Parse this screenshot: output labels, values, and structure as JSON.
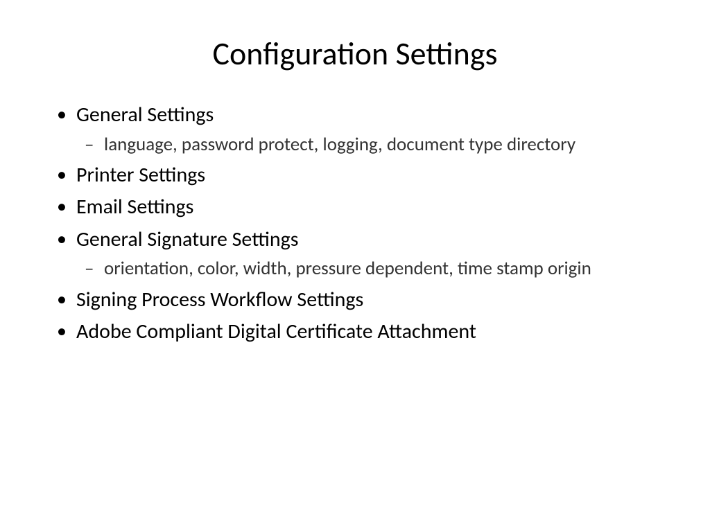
{
  "slide": {
    "title": "Configuration Settings",
    "bullets": [
      {
        "text": "General Settings",
        "sub": [
          "language, password protect, logging, document type directory"
        ]
      },
      {
        "text": "Printer Settings",
        "sub": []
      },
      {
        "text": "Email Settings",
        "sub": []
      },
      {
        "text": "General Signature Settings",
        "sub": [
          "orientation, color, width, pressure dependent, time stamp origin"
        ]
      },
      {
        "text": "Signing Process Workflow Settings",
        "sub": []
      },
      {
        "text": "Adobe Compliant Digital Certificate Attachment",
        "sub": []
      }
    ]
  }
}
